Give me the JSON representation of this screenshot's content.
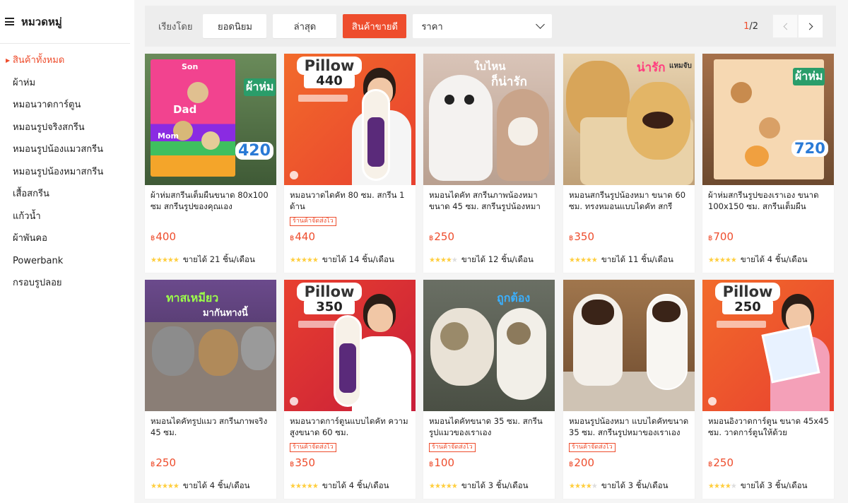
{
  "sidebar": {
    "title": "หมวดหมู่",
    "items": [
      {
        "label": "สินค้าทั้งหมด",
        "active": true
      },
      {
        "label": "ผ้าห่ม"
      },
      {
        "label": "หมอนวาดการ์ตูน"
      },
      {
        "label": "หมอนรูปจริงสกรีน"
      },
      {
        "label": "หมอนรูปน้องแมวสกรีน"
      },
      {
        "label": "หมอนรูปน้องหมาสกรีน"
      },
      {
        "label": "เสื้อสกรีน"
      },
      {
        "label": "แก้วน้ำ"
      },
      {
        "label": "ผ้าพันคอ"
      },
      {
        "label": "Powerbank"
      },
      {
        "label": "กรอบรูปลอย"
      }
    ]
  },
  "sortbar": {
    "label": "เรียงโดย",
    "options": [
      "ยอดนิยม",
      "ล่าสุด",
      "สินค้าขายดี"
    ],
    "active": "สินค้าขายดี",
    "price_label": "ราคา",
    "page_current": "1",
    "page_total": "/2"
  },
  "colors": {
    "accent": "#ee4d2d",
    "star": "#ffce3d"
  },
  "products": [
    {
      "name": "ผ้าห่มสกรีนเต็มผืนขนาด 80x100 ซม สกรีนรูปของคุณเอง",
      "badge": "",
      "currency": "฿",
      "price": "400",
      "rating": 5,
      "sold": "ขายได้ 21 ชิ้น/เดือน",
      "thumb": {
        "art": "blanket-pink",
        "texts": [
          "Son",
          "Dad",
          "Mom",
          "ผ้าห่ม",
          "420"
        ]
      }
    },
    {
      "name": "หมอนวาดไดคัท 80 ซม. สกรีน 1 ด้าน",
      "badge": "ร้านค้าจัดส่งไว",
      "currency": "฿",
      "price": "440",
      "rating": 5,
      "sold": "ขายได้ 14 ชิ้น/เดือน",
      "thumb": {
        "art": "pillow-promo",
        "texts": [
          "Pillow",
          "440"
        ]
      }
    },
    {
      "name": "หมอนไดคัท สกรีนภาพน้องหมา ขนาด 45 ซม. สกรีนรูปน้องหมาข...",
      "badge": "",
      "currency": "฿",
      "price": "250",
      "rating": 4,
      "sold": "ขายได้ 12 ชิ้น/เดือน",
      "thumb": {
        "art": "dog-pillows",
        "texts": [
          "ใบไหน",
          "ก็น่ารัก"
        ]
      }
    },
    {
      "name": "หมอนสกรีนรูปน้องหมา ขนาด 60 ซม. ทรงหมอนแบบไดคัท สกรีนภ...",
      "badge": "",
      "currency": "฿",
      "price": "350",
      "rating": 5,
      "sold": "ขายได้ 11 ชิ้น/เดือน",
      "thumb": {
        "art": "golden-dogs",
        "texts": [
          "น่ารัก",
          "แหมจับ"
        ]
      }
    },
    {
      "name": "ผ้าห่มสกรีนรูปของเราเอง ขนาด 100x150 ซม. สกรีนเต็มผืน",
      "badge": "",
      "currency": "฿",
      "price": "700",
      "rating": 5,
      "sold": "ขายได้ 4 ชิ้น/เดือน",
      "thumb": {
        "art": "blanket-peach",
        "texts": [
          "ผ้าห่ม",
          "720"
        ]
      }
    },
    {
      "name": "หมอนไดคัทรูปแมว สกรีนภาพจริง 45 ซม.",
      "badge": "",
      "currency": "฿",
      "price": "250",
      "rating": 5,
      "sold": "ขายได้ 4 ชิ้น/เดือน",
      "thumb": {
        "art": "cat-pillows",
        "texts": [
          "ทาสเหมียว",
          "มากันทางนี้"
        ]
      }
    },
    {
      "name": "หมอนวาดการ์ตูนแบบไดคัท ความสูงขนาด 60 ซม.",
      "badge": "ร้านค้าจัดส่งไว",
      "currency": "฿",
      "price": "350",
      "rating": 5,
      "sold": "ขายได้ 4 ชิ้น/เดือน",
      "thumb": {
        "art": "pillow-promo-red",
        "texts": [
          "Pillow",
          "350"
        ]
      }
    },
    {
      "name": "หมอนไดคัทขนาด 35 ซม. สกรีนรูปแมวของเราเอง",
      "badge": "ร้านค้าจัดส่งไว",
      "currency": "฿",
      "price": "100",
      "rating": 5,
      "sold": "ขายได้ 3 ชิ้น/เดือน",
      "thumb": {
        "art": "cat-photo",
        "texts": [
          "ถูกต้อง"
        ]
      }
    },
    {
      "name": "หมอนรูปน้องหมา แบบไดคัทขนาด 35 ซม. สกรีนรูปหมาของเราเอง",
      "badge": "ร้านค้าจัดส่งไว",
      "currency": "฿",
      "price": "200",
      "rating": 4,
      "sold": "ขายได้ 3 ชิ้น/เดือน",
      "thumb": {
        "art": "chihuahua",
        "texts": []
      }
    },
    {
      "name": "หมอนอิงวาดการ์ตูน ขนาด 45x45 ซม. วาดการ์ตูนให้ด้วย",
      "badge": "",
      "currency": "฿",
      "price": "250",
      "rating": 4,
      "sold": "ขายได้ 3 ชิ้น/เดือน",
      "thumb": {
        "art": "pillow-promo-square",
        "texts": [
          "Pillow",
          "250"
        ]
      }
    }
  ]
}
